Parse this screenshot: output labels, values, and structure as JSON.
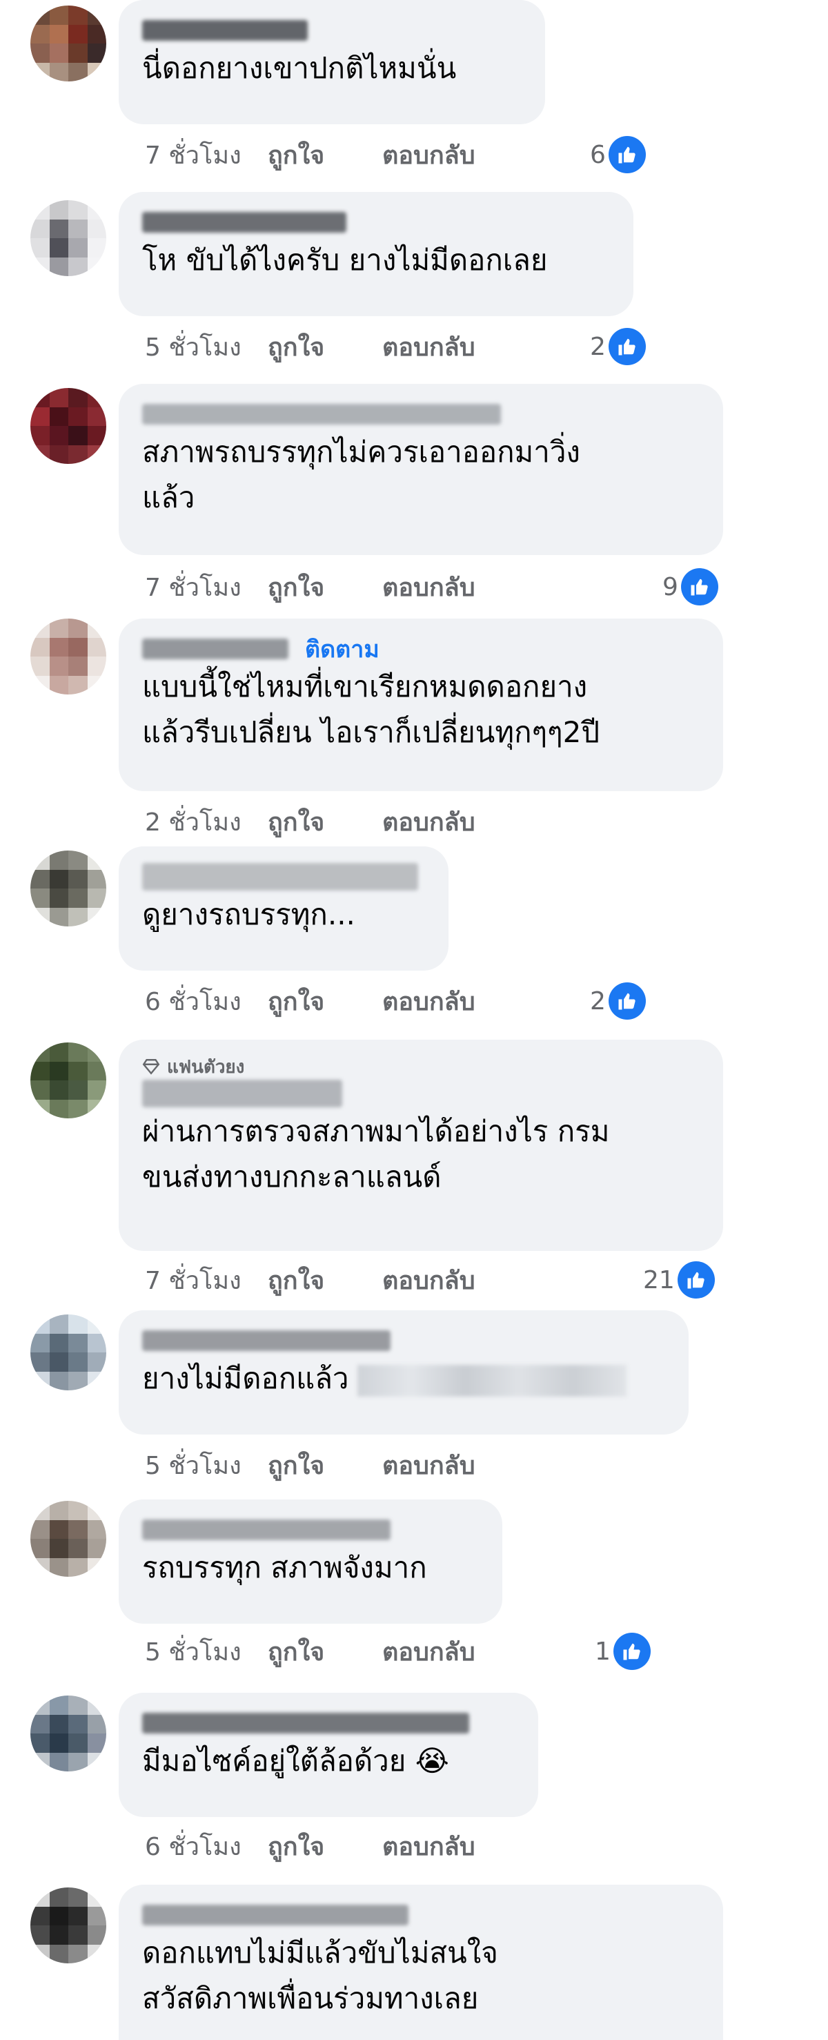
{
  "actions": {
    "like_label": "ถูกใจ",
    "reply_label": "ตอบกลับ"
  },
  "icons": {
    "like_reaction": "thumbs-up-icon",
    "fan_badge": "diamond-icon"
  },
  "colors": {
    "bubble": "#f0f2f5",
    "link": "#1877f2",
    "meta": "#65676b",
    "like_blue": "#1b78f2"
  },
  "comments": [
    {
      "lines": [
        "นี่ดอกยางเขาปกติไหมนั่น"
      ],
      "time": "7 ชั่วโมง",
      "likes": "6"
    },
    {
      "lines": [
        "โห ขับได้ไงครับ ยางไม่มีดอกเลย"
      ],
      "time": "5 ชั่วโมง",
      "likes": "2"
    },
    {
      "lines": [
        "สภาพรถบรรทุกไม่ควรเอาออกมาวิ่ง",
        "แล้ว"
      ],
      "time": "7 ชั่วโมง",
      "likes": "9"
    },
    {
      "follow": "ติดตาม",
      "lines": [
        "แบบนี้ใช่ไหมที่เขาเรียกหมดดอกยาง",
        "แล้วรีบเปลี่ยน ไอเราก็เปลี่ยนทุกๆๆ2ปี"
      ],
      "time": "2 ชั่วโมง"
    },
    {
      "lines": [
        "ดูยางรถบรรทุก..."
      ],
      "time": "6 ชั่วโมง",
      "likes": "2"
    },
    {
      "badge": "แฟนตัวยง",
      "lines": [
        "ผ่านการตรวจสภาพมาได้อย่างไร กรม",
        "ขนส่งทางบกกะลาแลนด์"
      ],
      "time": "7 ชั่วโมง",
      "likes": "21"
    },
    {
      "lines": [
        "ยางไม่มีดอกแล้ว"
      ],
      "time": "5 ชั่วโมง"
    },
    {
      "lines": [
        "รถบรรทุก สภาพจังมาก"
      ],
      "time": "5 ชั่วโมง",
      "likes": "1"
    },
    {
      "lines": [
        "มีมอไซค์อยู่ใต้ล้อด้วย 😭"
      ],
      "time": "6 ชั่วโมง"
    },
    {
      "lines": [
        "ดอกแทบไม่มีแล้วขับไม่สนใจ",
        "สวัสดิภาพเพื่อนร่วมทางเลย"
      ]
    }
  ]
}
